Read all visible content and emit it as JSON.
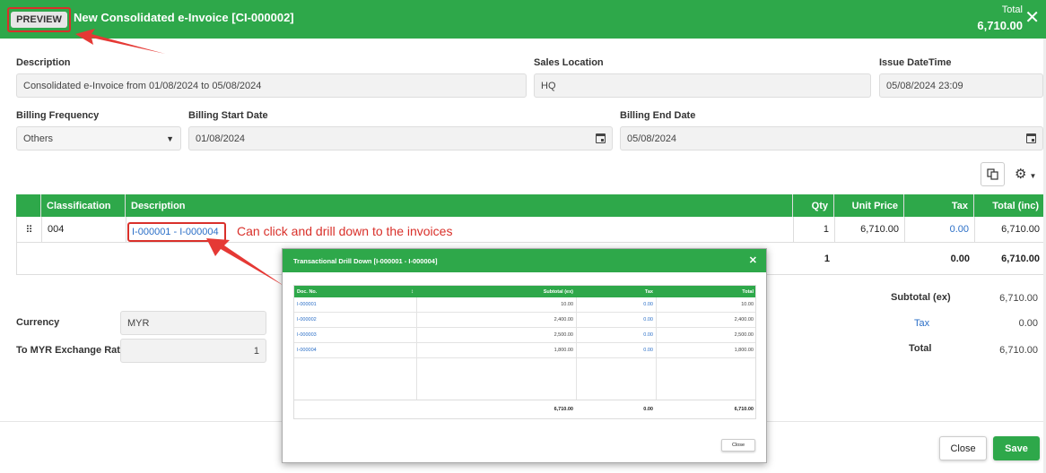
{
  "header": {
    "badge": "PREVIEW",
    "title": "New Consolidated e-Invoice [CI-000002]",
    "total_label": "Total",
    "total_value": "6,710.00"
  },
  "form": {
    "description_label": "Description",
    "description_value": "Consolidated e-Invoice from 01/08/2024 to 05/08/2024",
    "sales_location_label": "Sales Location",
    "sales_location_value": "HQ",
    "issue_datetime_label": "Issue DateTime",
    "issue_datetime_value": "05/08/2024 23:09",
    "billing_frequency_label": "Billing Frequency",
    "billing_frequency_value": "Others",
    "billing_start_label": "Billing Start Date",
    "billing_start_value": "01/08/2024",
    "billing_end_label": "Billing End Date",
    "billing_end_value": "05/08/2024"
  },
  "grid": {
    "columns": [
      "Classification",
      "Description",
      "Qty",
      "Unit Price",
      "Tax",
      "Total (inc)"
    ],
    "row": {
      "classification": "004",
      "description": "I-000001 - I-000004",
      "qty": "1",
      "unit_price": "6,710.00",
      "tax": "0.00",
      "total": "6,710.00"
    },
    "footer": {
      "qty": "1",
      "tax": "0.00",
      "total": "6,710.00"
    }
  },
  "annotation": "Can click and drill down to the invoices",
  "currency": {
    "currency_label": "Currency",
    "currency_value": "MYR",
    "rate_label": "To MYR Exchange Rate",
    "rate_value": "1"
  },
  "summary": {
    "subtotal_label": "Subtotal (ex)",
    "subtotal_value": "6,710.00",
    "tax_label": "Tax",
    "tax_value": "0.00",
    "total_label": "Total",
    "total_value": "6,710.00"
  },
  "modal": {
    "title": "Transactional Drill Down [I-000001 - I-000004]",
    "columns": [
      "Doc. No.",
      "Subtotal (ex)",
      "Tax",
      "Total"
    ],
    "rows": [
      {
        "doc": "I-000001",
        "subtotal": "10.00",
        "tax": "0.00",
        "total": "10.00"
      },
      {
        "doc": "I-000002",
        "subtotal": "2,400.00",
        "tax": "0.00",
        "total": "2,400.00"
      },
      {
        "doc": "I-000003",
        "subtotal": "2,500.00",
        "tax": "0.00",
        "total": "2,500.00"
      },
      {
        "doc": "I-000004",
        "subtotal": "1,800.00",
        "tax": "0.00",
        "total": "1,800.00"
      }
    ],
    "footer": {
      "subtotal": "6,710.00",
      "tax": "0.00",
      "total": "6,710.00"
    },
    "close_label": "Close"
  },
  "actions": {
    "close_label": "Close",
    "save_label": "Save"
  },
  "colors": {
    "accent": "#2ea84a",
    "annotation": "#d9302a",
    "link": "#2b6fc7"
  }
}
